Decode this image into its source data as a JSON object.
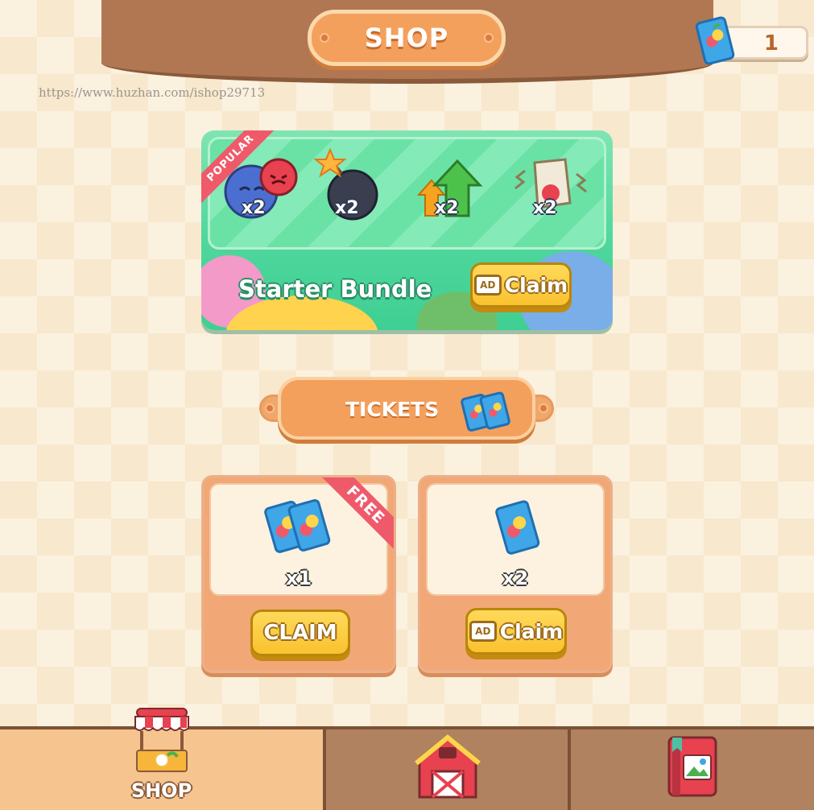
{
  "header": {
    "title": "SHOP",
    "ticket_count": "1"
  },
  "watermark": "https://www.huzhan.com/ishop29713",
  "starter_bundle": {
    "ribbon": "POPULAR",
    "title": "Starter Bundle",
    "items": [
      {
        "icon": "swap-fruit-icon",
        "qty": "x2"
      },
      {
        "icon": "bomb-icon",
        "qty": "x2"
      },
      {
        "icon": "upgrade-arrows-icon",
        "qty": "x2"
      },
      {
        "icon": "shake-box-icon",
        "qty": "x2"
      }
    ],
    "ad_label": "AD",
    "claim_label": "Claim"
  },
  "tickets_section": {
    "title": "TICKETS"
  },
  "offers": [
    {
      "ribbon": "FREE",
      "qty": "x1",
      "button": "CLAIM"
    },
    {
      "qty": "x2",
      "ad_label": "AD",
      "button": "Claim"
    }
  ],
  "bottom_nav": {
    "tabs": [
      {
        "label": "SHOP",
        "icon": "shop-stall-icon",
        "active": true
      },
      {
        "label": "",
        "icon": "barn-icon",
        "active": false
      },
      {
        "label": "",
        "icon": "photo-book-icon",
        "active": false
      }
    ]
  },
  "colors": {
    "accent_orange": "#f4a05d",
    "bundle_green": "#4fd79d",
    "button_yellow": "#f9c22f",
    "ribbon_red": "#ef5a6b",
    "wood": "#a47352"
  }
}
